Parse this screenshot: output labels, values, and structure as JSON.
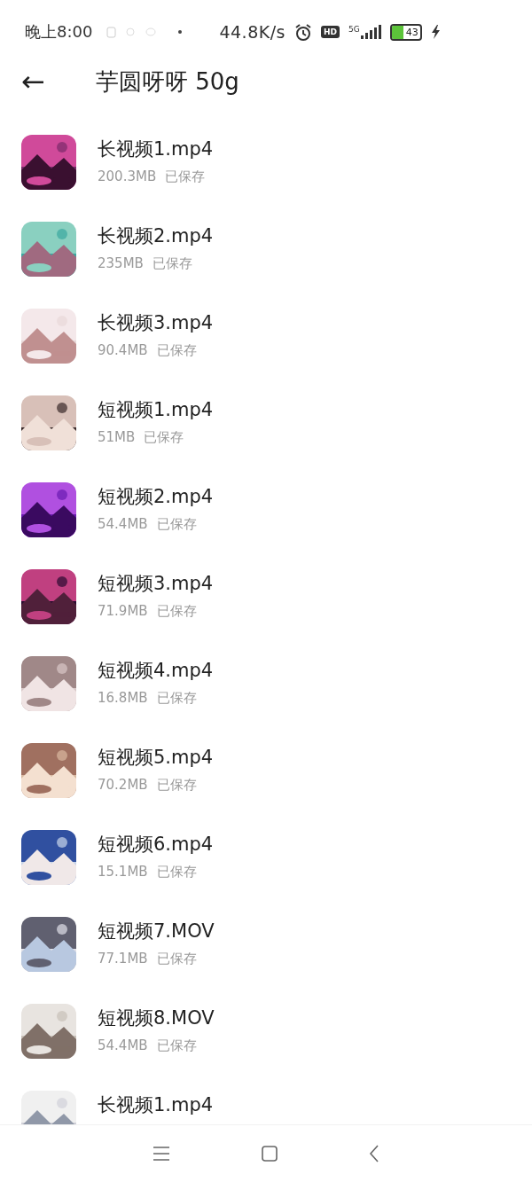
{
  "status_bar": {
    "time": "晚上8:00",
    "net_speed": "44.8K/s",
    "hd": "HD",
    "network": "5G",
    "battery": "43"
  },
  "header": {
    "back": "←",
    "title": "芋圆呀呀 50g"
  },
  "files": [
    {
      "name": "长视频1.mp4",
      "size": "200.3MB",
      "status": "已保存"
    },
    {
      "name": "长视频2.mp4",
      "size": "235MB",
      "status": "已保存"
    },
    {
      "name": "长视频3.mp4",
      "size": "90.4MB",
      "status": "已保存"
    },
    {
      "name": "短视频1.mp4",
      "size": "51MB",
      "status": "已保存"
    },
    {
      "name": "短视频2.mp4",
      "size": "54.4MB",
      "status": "已保存"
    },
    {
      "name": "短视频3.mp4",
      "size": "71.9MB",
      "status": "已保存"
    },
    {
      "name": "短视频4.mp4",
      "size": "16.8MB",
      "status": "已保存"
    },
    {
      "name": "短视频5.mp4",
      "size": "70.2MB",
      "status": "已保存"
    },
    {
      "name": "短视频6.mp4",
      "size": "15.1MB",
      "status": "已保存"
    },
    {
      "name": "短视频7.MOV",
      "size": "77.1MB",
      "status": "已保存"
    },
    {
      "name": "短视频8.MOV",
      "size": "54.4MB",
      "status": "已保存"
    },
    {
      "name": "长视频1.mp4"
    }
  ]
}
